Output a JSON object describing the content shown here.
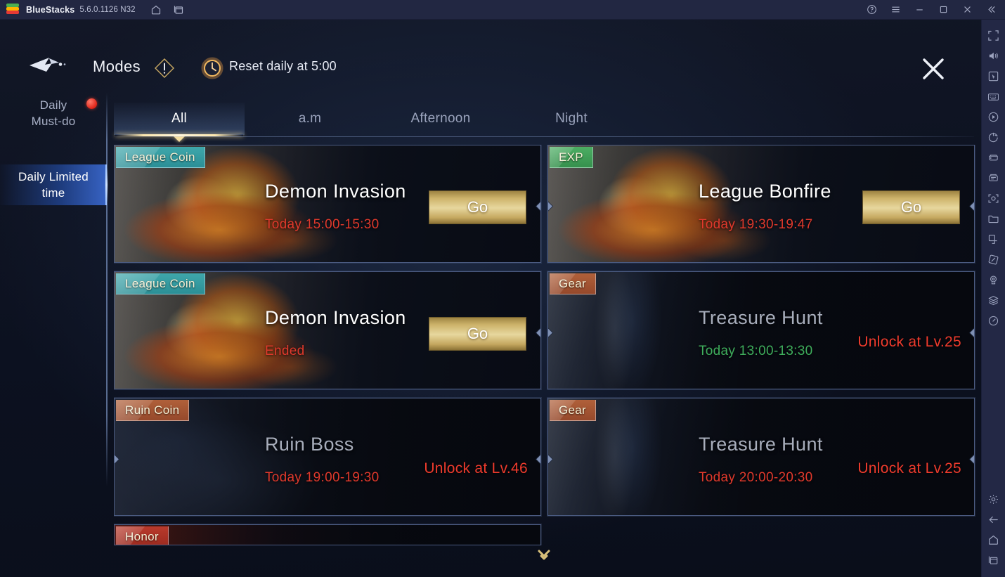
{
  "titlebar": {
    "app_name": "BlueStacks",
    "version": "5.6.0.1126 N32",
    "left_icons": [
      "home-icon",
      "multi-window-icon"
    ],
    "right_icons": [
      "help-icon",
      "menu-icon",
      "minimize-icon",
      "maximize-icon",
      "close-icon",
      "collapse-icon"
    ]
  },
  "game_header": {
    "back_label": "back-arrow",
    "title": "Modes",
    "info_icon": "info-diamond-icon",
    "clock_icon": "clock-icon",
    "reset_text": "Reset daily at 5:00",
    "close_label": "close-x"
  },
  "sidebar": {
    "items": [
      {
        "label": "Daily\nMust-do",
        "selected": false,
        "badge_dot": true
      },
      {
        "label": "Daily Limited\ntime",
        "selected": true,
        "badge_dot": false
      }
    ]
  },
  "tabs": {
    "items": [
      {
        "label": "All",
        "active": true
      },
      {
        "label": "a.m",
        "active": false
      },
      {
        "label": "Afternoon",
        "active": false
      },
      {
        "label": "Night",
        "active": false
      }
    ]
  },
  "cards": [
    {
      "badge": "League Coin",
      "badge_color": "teal",
      "badge_hex": "#3fa7ab",
      "title": "Demon Invasion",
      "time": "Today 15:00-15:30",
      "time_color": "red",
      "action": "Go",
      "locked": false,
      "art": "fire"
    },
    {
      "badge": "EXP",
      "badge_color": "green",
      "badge_hex": "#4cae63",
      "title": "League Bonfire",
      "time": "Today 19:30-19:47",
      "time_color": "red",
      "action": "Go",
      "locked": false,
      "art": "fire"
    },
    {
      "badge": "League Coin",
      "badge_color": "teal",
      "badge_hex": "#3fa7ab",
      "title": "Demon Invasion",
      "time": "Ended",
      "time_color": "red",
      "action": "Go",
      "locked": false,
      "art": "fire"
    },
    {
      "badge": "Gear",
      "badge_color": "orange",
      "badge_hex": "#b0603a",
      "title": "Treasure Hunt",
      "time": "Today 13:00-13:30",
      "time_color": "green",
      "lock_text": "Unlock at Lv.25",
      "locked": true,
      "art": "cave"
    },
    {
      "badge": "Ruin Coin",
      "badge_color": "orange",
      "badge_hex": "#b0603a",
      "title": "Ruin Boss",
      "time": "Today 19:00-19:30",
      "time_color": "red",
      "lock_text": "Unlock at Lv.46",
      "locked": true,
      "art": "ruin"
    },
    {
      "badge": "Gear",
      "badge_color": "orange",
      "badge_hex": "#b0603a",
      "title": "Treasure Hunt",
      "time": "Today 20:00-20:30",
      "time_color": "red",
      "lock_text": "Unlock at Lv.25",
      "locked": true,
      "art": "cave"
    },
    {
      "badge": "Honor",
      "badge_color": "red",
      "badge_hex": "#b93a2c",
      "title": "",
      "time": "",
      "time_color": "red",
      "locked": true,
      "art": "honor",
      "partial": true
    }
  ],
  "scroll_indicator": "chevron-double-down-icon",
  "rail": {
    "top_icons": [
      "fullscreen-icon",
      "volume-icon",
      "pointer-icon",
      "keyboard-icon",
      "play-icon",
      "rotate-icon",
      "gamepad-icon",
      "multi-instance-icon",
      "screenshot-icon",
      "folder-icon",
      "copy-icon",
      "tilt-icon",
      "location-icon",
      "layers-icon",
      "gauge-icon"
    ],
    "bottom_icons": [
      "gear-icon",
      "back-icon",
      "home-icon",
      "recents-icon"
    ]
  },
  "colors": {
    "accent_gold": "#e7d79e",
    "danger_red": "#ee3b2d",
    "ok_green": "#3fae5d",
    "select_blue": "#3763c4",
    "chrome_navy": "#222742"
  }
}
